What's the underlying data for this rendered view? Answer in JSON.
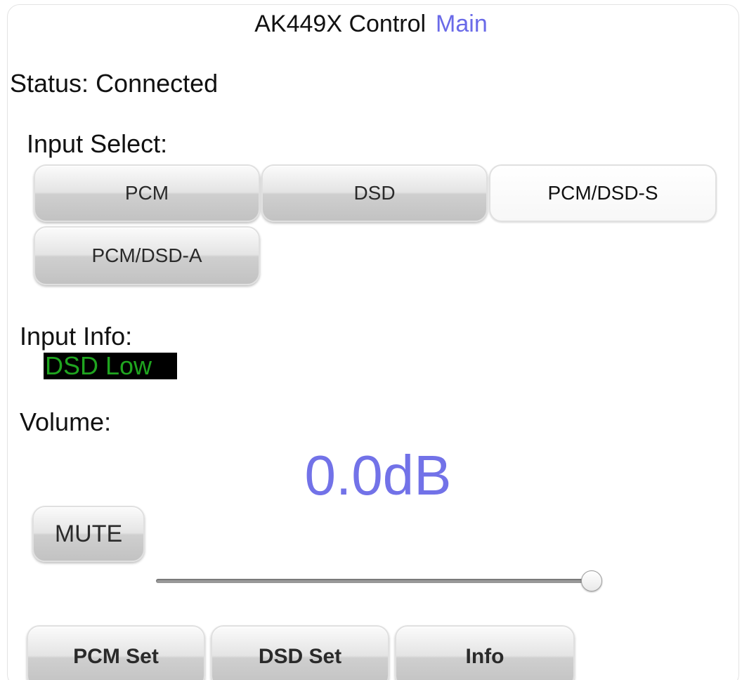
{
  "header": {
    "title": "AK449X Control",
    "main_link": "Main"
  },
  "status": {
    "text": "Status: Connected"
  },
  "input_select": {
    "label": "Input Select:",
    "options": [
      "PCM",
      "DSD",
      "PCM/DSD-S",
      "PCM/DSD-A"
    ],
    "selected": "PCM/DSD-S"
  },
  "input_info": {
    "label": "Input Info:",
    "value": "DSD Low",
    "colors": {
      "background": "#000000",
      "text": "#1fa51f"
    }
  },
  "volume": {
    "label": "Volume:",
    "value_text": "0.0dB",
    "slider_level": 1.0,
    "mute_label": "MUTE"
  },
  "footer": {
    "pcm_set_label": "PCM Set",
    "dsd_set_label": "DSD Set",
    "info_label": "Info"
  },
  "colors": {
    "accent": "#6a6ae8",
    "volume_text": "#7272e8"
  }
}
